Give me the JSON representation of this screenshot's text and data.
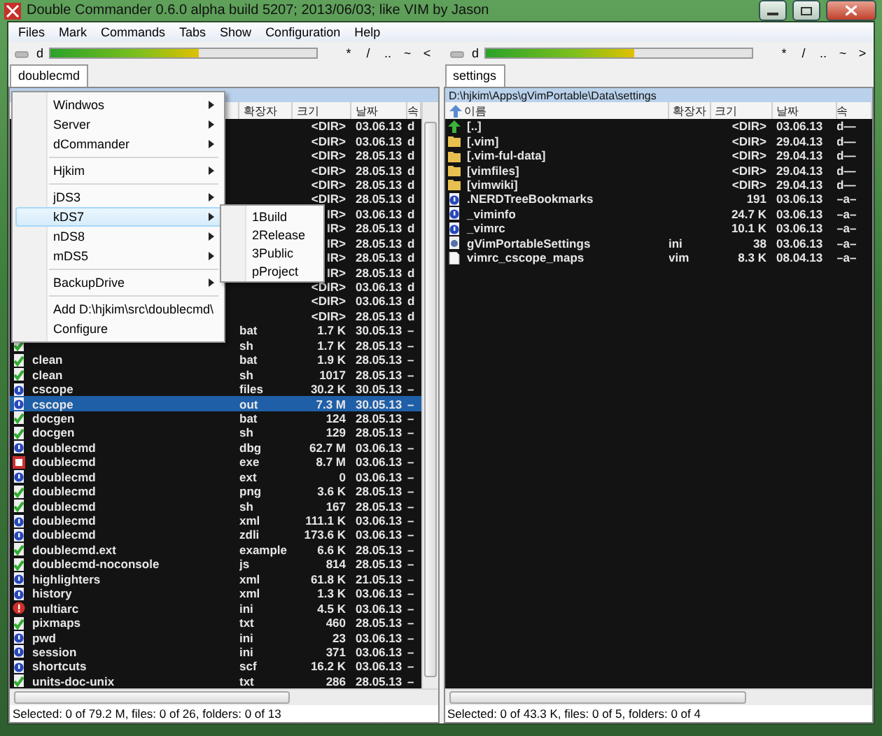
{
  "window": {
    "title": "Double Commander 0.6.0 alpha build 5207; 2013/06/03; like VIM by Jason"
  },
  "menu_bar": [
    "Files",
    "Mark",
    "Commands",
    "Tabs",
    "Show",
    "Configuration",
    "Help"
  ],
  "panels": [
    {
      "drive": {
        "letter": "d",
        "level": 0.56
      },
      "nav_buttons": [
        "*",
        "/",
        "..",
        "~",
        "<"
      ],
      "tab": {
        "label": "doublecmd",
        "selected": true
      },
      "columns": [
        {
          "kind": "name"
        },
        {
          "kind": "ext",
          "label": "확장자"
        },
        {
          "kind": "size",
          "label": "크기"
        },
        {
          "kind": "date",
          "label": "날짜"
        },
        {
          "kind": "attr",
          "label": "속"
        }
      ],
      "rows": [
        {
          "kind": "dir",
          "size": "<DIR>",
          "date": "03.06.13",
          "attr": "d",
          "selected": false
        },
        {
          "kind": "dir",
          "size": "<DIR>",
          "date": "03.06.13",
          "attr": "d",
          "selected": false
        },
        {
          "kind": "dir",
          "size": "<DIR>",
          "date": "28.05.13",
          "attr": "d",
          "selected": false
        },
        {
          "kind": "dir",
          "size": "<DIR>",
          "date": "28.05.13",
          "attr": "d",
          "selected": false
        },
        {
          "kind": "dir",
          "size": "<DIR>",
          "date": "28.05.13",
          "attr": "d",
          "selected": false
        },
        {
          "kind": "dir",
          "size": "<DIR>",
          "date": "28.05.13",
          "attr": "d",
          "selected": false
        },
        {
          "kind": "dir",
          "size": "IR>",
          "date": "03.06.13",
          "attr": "d",
          "selected": false
        },
        {
          "kind": "dir",
          "size": "IR>",
          "date": "28.05.13",
          "attr": "d",
          "selected": false
        },
        {
          "kind": "dir",
          "size": "IR>",
          "date": "28.05.13",
          "attr": "d",
          "selected": false
        },
        {
          "kind": "dir",
          "size": "IR>",
          "date": "28.05.13",
          "attr": "d",
          "selected": false
        },
        {
          "kind": "dir",
          "size": "IR>",
          "date": "28.05.13",
          "attr": "d",
          "selected": false
        },
        {
          "kind": "dir",
          "size": "<DIR>",
          "date": "03.06.13",
          "attr": "d",
          "selected": false
        },
        {
          "kind": "dir",
          "size": "<DIR>",
          "date": "03.06.13",
          "attr": "d",
          "selected": false
        },
        {
          "kind": "dir",
          "size": "<DIR>",
          "date": "28.05.13",
          "attr": "d",
          "selected": false
        },
        {
          "ext": "bat",
          "size": "1.7 K",
          "date": "30.05.13",
          "attr": "–",
          "selected": false
        },
        {
          "kind": "script",
          "ext": "sh",
          "size": "1.7 K",
          "date": "28.05.13",
          "attr": "–",
          "selected": false
        },
        {
          "kind": "script",
          "name": "clean",
          "ext": "bat",
          "size": "1.9 K",
          "date": "28.05.13",
          "attr": "–",
          "selected": false
        },
        {
          "kind": "script",
          "name": "clean",
          "ext": "sh",
          "size": "1017",
          "date": "28.05.13",
          "attr": "–",
          "selected": false
        },
        {
          "kind": "unknown",
          "name": "cscope",
          "ext": "files",
          "size": "30.2 K",
          "date": "30.05.13",
          "attr": "–",
          "selected": false
        },
        {
          "kind": "unknown",
          "name": "cscope",
          "ext": "out",
          "size": "7.3 M",
          "date": "30.05.13",
          "attr": "–",
          "selected": true
        },
        {
          "kind": "script",
          "name": "docgen",
          "ext": "bat",
          "size": "124",
          "date": "28.05.13",
          "attr": "–",
          "selected": false
        },
        {
          "kind": "script",
          "name": "docgen",
          "ext": "sh",
          "size": "129",
          "date": "28.05.13",
          "attr": "–",
          "selected": false
        },
        {
          "kind": "unknown",
          "name": "doublecmd",
          "ext": "dbg",
          "size": "62.7 M",
          "date": "03.06.13",
          "attr": "–",
          "selected": false
        },
        {
          "kind": "app",
          "name": "doublecmd",
          "ext": "exe",
          "size": "8.7 M",
          "date": "03.06.13",
          "attr": "–",
          "selected": false
        },
        {
          "kind": "unknown",
          "name": "doublecmd",
          "ext": "ext",
          "size": "0",
          "date": "03.06.13",
          "attr": "–",
          "selected": false
        },
        {
          "kind": "script",
          "name": "doublecmd",
          "ext": "png",
          "size": "3.6 K",
          "date": "28.05.13",
          "attr": "–",
          "selected": false
        },
        {
          "kind": "script",
          "name": "doublecmd",
          "ext": "sh",
          "size": "167",
          "date": "28.05.13",
          "attr": "–",
          "selected": false
        },
        {
          "kind": "unknown",
          "name": "doublecmd",
          "ext": "xml",
          "size": "111.1 K",
          "date": "03.06.13",
          "attr": "–",
          "selected": false
        },
        {
          "kind": "unknown",
          "name": "doublecmd",
          "ext": "zdli",
          "size": "173.6 K",
          "date": "03.06.13",
          "attr": "–",
          "selected": false
        },
        {
          "kind": "script",
          "name": "doublecmd.ext",
          "ext": "example",
          "size": "6.6 K",
          "date": "28.05.13",
          "attr": "–",
          "selected": false
        },
        {
          "kind": "script",
          "name": "doublecmd-noconsole",
          "ext": "js",
          "size": "814",
          "date": "28.05.13",
          "attr": "–",
          "selected": false
        },
        {
          "kind": "unknown",
          "name": "highlighters",
          "ext": "xml",
          "size": "61.8 K",
          "date": "21.05.13",
          "attr": "–",
          "selected": false
        },
        {
          "kind": "unknown",
          "name": "history",
          "ext": "xml",
          "size": "1.3 K",
          "date": "03.06.13",
          "attr": "–",
          "selected": false
        },
        {
          "kind": "alert",
          "name": "multiarc",
          "ext": "ini",
          "size": "4.5 K",
          "date": "03.06.13",
          "attr": "–",
          "selected": false
        },
        {
          "kind": "script",
          "name": "pixmaps",
          "ext": "txt",
          "size": "460",
          "date": "28.05.13",
          "attr": "–",
          "selected": false
        },
        {
          "kind": "unknown",
          "name": "pwd",
          "ext": "ini",
          "size": "23",
          "date": "03.06.13",
          "attr": "–",
          "selected": false
        },
        {
          "kind": "unknown",
          "name": "session",
          "ext": "ini",
          "size": "371",
          "date": "03.06.13",
          "attr": "–",
          "selected": false
        },
        {
          "kind": "unknown",
          "name": "shortcuts",
          "ext": "scf",
          "size": "16.2 K",
          "date": "03.06.13",
          "attr": "–",
          "selected": false
        },
        {
          "kind": "script",
          "name": "units-doc-unix",
          "ext": "txt",
          "size": "286",
          "date": "28.05.13",
          "attr": "–",
          "selected": false
        }
      ],
      "status": "Selected: 0 of 79.2 M, files: 0 of 26, folders: 0 of 13"
    },
    {
      "drive": {
        "letter": "d",
        "level": 0.56
      },
      "nav_buttons": [
        "*",
        "/",
        "..",
        "~",
        ">"
      ],
      "tab": {
        "label": "settings",
        "selected": true
      },
      "path": "D:\\hjkim\\Apps\\gVimPortable\\Data\\settings",
      "columns": [
        {
          "kind": "name",
          "label": "이름"
        },
        {
          "kind": "ext",
          "label": "확장자"
        },
        {
          "kind": "size",
          "label": "크기"
        },
        {
          "kind": "date",
          "label": "날짜"
        },
        {
          "kind": "attr",
          "label": "속"
        }
      ],
      "rows": [
        {
          "kind": "up",
          "name": "[..]",
          "size": "<DIR>",
          "date": "03.06.13",
          "attr": "d—",
          "selected": false
        },
        {
          "kind": "folder",
          "name": "[.vim]",
          "size": "<DIR>",
          "date": "29.04.13",
          "attr": "d—",
          "selected": false
        },
        {
          "kind": "folder",
          "name": "[.vim-ful-data]",
          "size": "<DIR>",
          "date": "29.04.13",
          "attr": "d—",
          "selected": false
        },
        {
          "kind": "folder",
          "name": "[vimfiles]",
          "size": "<DIR>",
          "date": "29.04.13",
          "attr": "d—",
          "selected": false
        },
        {
          "kind": "folder",
          "name": "[vimwiki]",
          "size": "<DIR>",
          "date": "29.04.13",
          "attr": "d—",
          "selected": false
        },
        {
          "kind": "unknown",
          "name": ".NERDTreeBookmarks",
          "size": "191",
          "date": "03.06.13",
          "attr": "–a–",
          "selected": false
        },
        {
          "kind": "unknown",
          "name": "_viminfo",
          "size": "24.7 K",
          "date": "03.06.13",
          "attr": "–a–",
          "selected": false
        },
        {
          "kind": "unknown",
          "name": "_vimrc",
          "size": "10.1 K",
          "date": "03.06.13",
          "attr": "–a–",
          "selected": false
        },
        {
          "kind": "config",
          "name": "gVimPortableSettings",
          "ext": "ini",
          "size": "38",
          "date": "03.06.13",
          "attr": "–a–",
          "selected": false
        },
        {
          "kind": "blank",
          "name": "vimrc_cscope_maps",
          "ext": "vim",
          "size": "8.3 K",
          "date": "08.04.13",
          "attr": "–a–",
          "selected": false
        }
      ],
      "status": "Selected: 0 of 43.3 K, files: 0 of 5, folders: 0 of 4"
    }
  ],
  "bookmark_menu": {
    "items": [
      {
        "kind": "item",
        "label": "Windwos",
        "submenu": true,
        "selected": false
      },
      {
        "kind": "item",
        "label": "Server",
        "submenu": true,
        "selected": false
      },
      {
        "kind": "item",
        "label": "dCommander",
        "submenu": true,
        "selected": false
      },
      {
        "kind": "separator"
      },
      {
        "kind": "item",
        "label": "Hjkim",
        "submenu": true,
        "selected": false
      },
      {
        "kind": "separator"
      },
      {
        "kind": "item",
        "label": "jDS3",
        "submenu": true,
        "selected": false
      },
      {
        "kind": "item",
        "label": "kDS7",
        "submenu": true,
        "selected": true
      },
      {
        "kind": "item",
        "label": "nDS8",
        "submenu": true,
        "selected": false
      },
      {
        "kind": "item",
        "label": "mDS5",
        "submenu": true,
        "selected": false
      },
      {
        "kind": "separator"
      },
      {
        "kind": "item",
        "label": "BackupDrive",
        "submenu": true,
        "selected": false
      },
      {
        "kind": "separator"
      },
      {
        "kind": "item",
        "label": "Add D:\\hjkim\\src\\doublecmd\\",
        "submenu": false,
        "selected": false
      },
      {
        "kind": "item",
        "label": "Configure",
        "submenu": false,
        "selected": false
      }
    ],
    "submenu": {
      "items": [
        {
          "kind": "item",
          "label": "1Build",
          "submenu": false,
          "selected": false
        },
        {
          "kind": "item",
          "label": "2Release",
          "submenu": false,
          "selected": false
        },
        {
          "kind": "item",
          "label": "3Public",
          "submenu": false,
          "selected": false
        },
        {
          "kind": "item",
          "label": "pProject",
          "submenu": false,
          "selected": false
        }
      ]
    }
  }
}
